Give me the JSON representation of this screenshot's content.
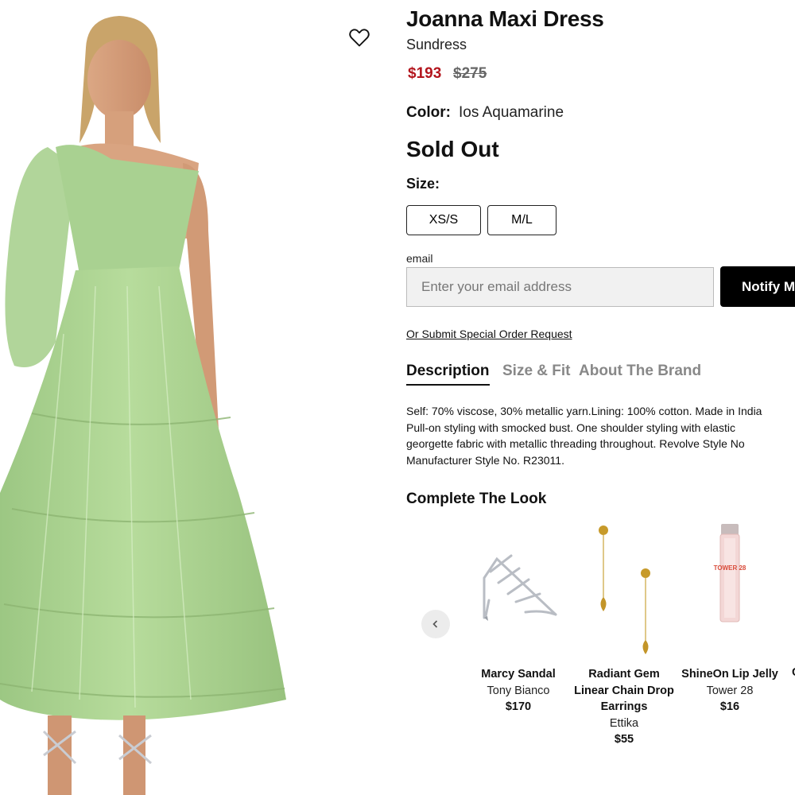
{
  "product": {
    "title": "Joanna Maxi Dress",
    "subtitle": "Sundress",
    "sale_price": "$193",
    "original_price": "$275",
    "color_label": "Color:",
    "color_value": "Ios Aquamarine",
    "status": "Sold Out",
    "size_label": "Size:",
    "sizes": [
      "XS/S",
      "M/L"
    ]
  },
  "notify": {
    "email_label": "email",
    "email_placeholder": "Enter your email address",
    "button_label": "Notify Me",
    "special_order_link": "Or Submit Special Order Request"
  },
  "tabs": [
    {
      "label": "Description",
      "active": true
    },
    {
      "label": "Size & Fit",
      "active": false
    },
    {
      "label": "About The Brand",
      "active": false
    }
  ],
  "description_lines": [
    "Self: 70% viscose, 30% metallic yarn.Lining: 100% cotton. Made in India",
    "Pull-on styling with smocked bust. One shoulder styling with elastic",
    "georgette fabric with metallic threading throughout. Revolve Style No",
    "Manufacturer Style No. R23011."
  ],
  "complete_the_look": {
    "heading": "Complete The Look",
    "items": [
      {
        "name": "Marcy Sandal",
        "brand": "Tony Bianco",
        "price": "$170"
      },
      {
        "name": "Radiant Gem Linear Chain Drop Earrings",
        "brand": "Ettika",
        "price": "$55"
      },
      {
        "name": "ShineOn Lip Jelly",
        "brand": "Tower 28",
        "price": "$16"
      }
    ],
    "partial_next_initial": "C"
  },
  "colors": {
    "accent_sale": "#b3151d",
    "dress_green": "#a6cf8a",
    "button_black": "#000000"
  },
  "icons": {
    "favorite": "heart-outline-icon",
    "carousel_prev": "chevron-left-icon"
  },
  "image_text": {
    "lip_jelly_label": "TOWER 28"
  }
}
